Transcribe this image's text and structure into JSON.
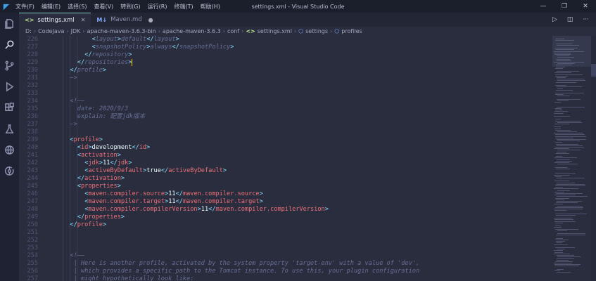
{
  "titlebar": {
    "menu": [
      "文件(F)",
      "编辑(E)",
      "选择(S)",
      "查看(V)",
      "转到(G)",
      "运行(R)",
      "终端(T)",
      "帮助(H)"
    ],
    "title": "settings.xml - Visual Studio Code"
  },
  "tabs": [
    {
      "icon": "xml",
      "label": "settings.xml",
      "active": true
    },
    {
      "icon": "md",
      "label": "Maven.md",
      "active": false
    }
  ],
  "breadcrumb": [
    "D:",
    "CodeJava",
    "JDK",
    "apache-maven-3.6.3-bin",
    "apache-maven-3.6.3",
    "conf",
    "settings.xml",
    "settings",
    "profiles"
  ],
  "colors": {
    "accent": "#80cbc4",
    "tag": "#f07178",
    "punct": "#89ddff",
    "comment": "#676e95",
    "bg": "#292d3e"
  },
  "icons": {
    "activity": [
      "explorer-icon",
      "search-icon",
      "source-control-icon",
      "run-debug-icon",
      "extensions-icon",
      "testing-icon",
      "remote-explorer-icon",
      "timeline-icon"
    ]
  },
  "code": {
    "lines": [
      {
        "n": "226",
        "indent": 8,
        "parts": [
          [
            "p",
            "<"
          ],
          [
            "c",
            "layout"
          ],
          [
            "p",
            ">"
          ],
          [
            "c",
            "default"
          ],
          [
            "p",
            "</"
          ],
          [
            "c",
            "layout"
          ],
          [
            "p",
            ">"
          ]
        ]
      },
      {
        "n": "227",
        "indent": 8,
        "parts": [
          [
            "p",
            "<"
          ],
          [
            "c",
            "snapshotPolicy"
          ],
          [
            "p",
            ">"
          ],
          [
            "c",
            "always"
          ],
          [
            "p",
            "</"
          ],
          [
            "c",
            "snapshotPolicy"
          ],
          [
            "p",
            ">"
          ]
        ]
      },
      {
        "n": "228",
        "indent": 6,
        "parts": [
          [
            "p",
            "</"
          ],
          [
            "c",
            "repository"
          ],
          [
            "p",
            ">"
          ]
        ]
      },
      {
        "n": "229",
        "indent": 4,
        "parts": [
          [
            "p",
            "</"
          ],
          [
            "c",
            "repositories"
          ],
          [
            "p",
            ">"
          ]
        ]
      },
      {
        "n": "230",
        "indent": 2,
        "parts": [
          [
            "p",
            "</"
          ],
          [
            "c",
            "profile"
          ],
          [
            "p",
            ">"
          ]
        ]
      },
      {
        "n": "231",
        "indent": 2,
        "parts": [
          [
            "c",
            "—>"
          ]
        ]
      },
      {
        "n": "232",
        "indent": 0,
        "parts": []
      },
      {
        "n": "233",
        "indent": 0,
        "parts": []
      },
      {
        "n": "234",
        "indent": 2,
        "parts": [
          [
            "c",
            "<!——"
          ]
        ]
      },
      {
        "n": "235",
        "indent": 4,
        "parts": [
          [
            "c",
            "date: 2020/9/3"
          ]
        ]
      },
      {
        "n": "236",
        "indent": 4,
        "parts": [
          [
            "c",
            "explain: 配置jdk版本"
          ]
        ]
      },
      {
        "n": "237",
        "indent": 2,
        "parts": [
          [
            "c",
            "—>"
          ]
        ]
      },
      {
        "n": "238",
        "indent": 0,
        "parts": []
      },
      {
        "n": "239",
        "indent": 2,
        "parts": [
          [
            "p",
            "<"
          ],
          [
            "t",
            "profile"
          ],
          [
            "p",
            ">"
          ]
        ]
      },
      {
        "n": "240",
        "indent": 4,
        "parts": [
          [
            "p",
            "<"
          ],
          [
            "t",
            "id"
          ],
          [
            "p",
            ">"
          ],
          [
            "w",
            "development"
          ],
          [
            "p",
            "</"
          ],
          [
            "t",
            "id"
          ],
          [
            "p",
            ">"
          ]
        ]
      },
      {
        "n": "241",
        "indent": 4,
        "parts": [
          [
            "p",
            "<"
          ],
          [
            "t",
            "activation"
          ],
          [
            "p",
            ">"
          ]
        ]
      },
      {
        "n": "242",
        "indent": 6,
        "parts": [
          [
            "p",
            "<"
          ],
          [
            "t",
            "jdk"
          ],
          [
            "p",
            ">"
          ],
          [
            "w",
            "11"
          ],
          [
            "p",
            "</"
          ],
          [
            "t",
            "jdk"
          ],
          [
            "p",
            ">"
          ]
        ]
      },
      {
        "n": "243",
        "indent": 6,
        "parts": [
          [
            "p",
            "<"
          ],
          [
            "t",
            "activeByDefault"
          ],
          [
            "p",
            ">"
          ],
          [
            "w",
            "true"
          ],
          [
            "p",
            "</"
          ],
          [
            "t",
            "activeByDefault"
          ],
          [
            "p",
            ">"
          ]
        ]
      },
      {
        "n": "244",
        "indent": 4,
        "parts": [
          [
            "p",
            "</"
          ],
          [
            "t",
            "activation"
          ],
          [
            "p",
            ">"
          ]
        ]
      },
      {
        "n": "245",
        "indent": 4,
        "parts": [
          [
            "p",
            "<"
          ],
          [
            "t",
            "properties"
          ],
          [
            "p",
            ">"
          ]
        ]
      },
      {
        "n": "246",
        "indent": 6,
        "parts": [
          [
            "p",
            "<"
          ],
          [
            "t",
            "maven.compiler.source"
          ],
          [
            "p",
            ">"
          ],
          [
            "w",
            "11"
          ],
          [
            "p",
            "</"
          ],
          [
            "t",
            "maven.compiler.source"
          ],
          [
            "p",
            ">"
          ]
        ]
      },
      {
        "n": "247",
        "indent": 6,
        "parts": [
          [
            "p",
            "<"
          ],
          [
            "t",
            "maven.compiler.target"
          ],
          [
            "p",
            ">"
          ],
          [
            "w",
            "11"
          ],
          [
            "p",
            "</"
          ],
          [
            "t",
            "maven.compiler.target"
          ],
          [
            "p",
            ">"
          ]
        ]
      },
      {
        "n": "248",
        "indent": 6,
        "parts": [
          [
            "p",
            "<"
          ],
          [
            "t",
            "maven.compiler.compilerVersion"
          ],
          [
            "p",
            ">"
          ],
          [
            "w",
            "11"
          ],
          [
            "p",
            "</"
          ],
          [
            "t",
            "maven.compiler.compilerVersion"
          ],
          [
            "p",
            ">"
          ]
        ]
      },
      {
        "n": "249",
        "indent": 4,
        "parts": [
          [
            "p",
            "</"
          ],
          [
            "t",
            "properties"
          ],
          [
            "p",
            ">"
          ]
        ]
      },
      {
        "n": "250",
        "indent": 2,
        "parts": [
          [
            "p",
            "</"
          ],
          [
            "t",
            "profile"
          ],
          [
            "p",
            ">"
          ]
        ]
      },
      {
        "n": "251",
        "indent": 0,
        "parts": []
      },
      {
        "n": "252",
        "indent": 0,
        "parts": []
      },
      {
        "n": "253",
        "indent": 0,
        "parts": []
      },
      {
        "n": "254",
        "indent": 2,
        "parts": [
          [
            "c",
            "<!——"
          ]
        ]
      },
      {
        "n": "255",
        "indent": 3,
        "parts": [
          [
            "c",
            "| Here is another profile, activated by the system property 'target-env' with a value of 'dev',"
          ]
        ]
      },
      {
        "n": "256",
        "indent": 3,
        "parts": [
          [
            "c",
            "| which provides a specific path to the Tomcat instance. To use this, your plugin configuration"
          ]
        ]
      },
      {
        "n": "257",
        "indent": 3,
        "parts": [
          [
            "c",
            "| might hypothetically look like:"
          ]
        ]
      }
    ]
  }
}
